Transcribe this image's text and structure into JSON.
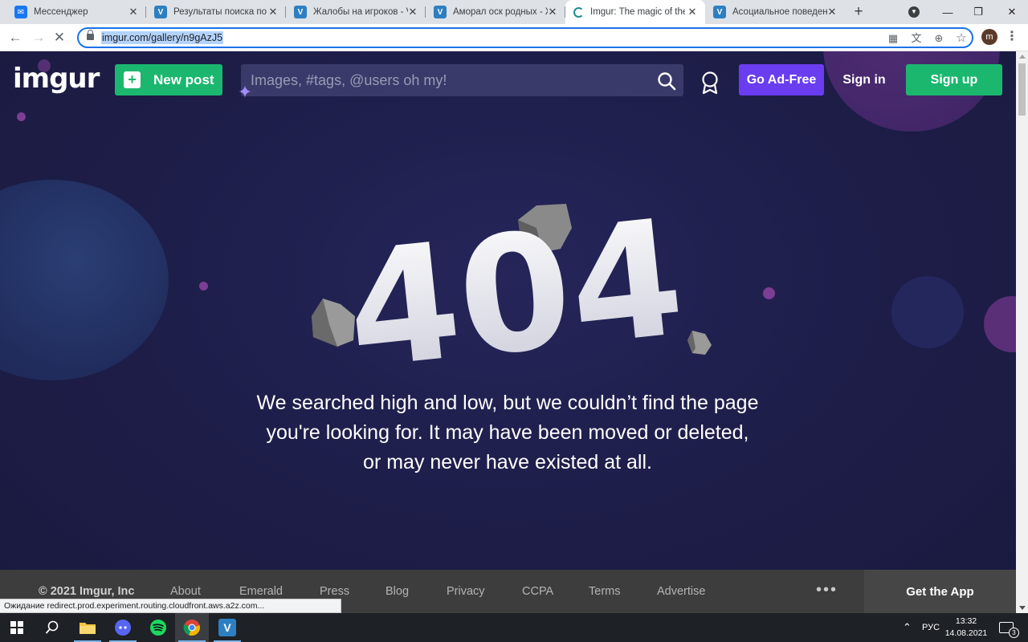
{
  "browser": {
    "tabs": [
      {
        "title": "Мессенджер",
        "favicon": "messenger-icon",
        "color": "#1877f2"
      },
      {
        "title": "Результаты поиска по \"I",
        "favicon": "vimeworld-icon",
        "color": "#2d7fc1"
      },
      {
        "title": "Жалобы на игроков - V",
        "favicon": "vimeworld-icon",
        "color": "#2d7fc1"
      },
      {
        "title": "Аморал оск родных - Ж",
        "favicon": "vimeworld-icon",
        "color": "#2d7fc1"
      },
      {
        "title": "Imgur: The magic of the",
        "favicon": "loading-spinner-icon",
        "color": "#1e8e8e",
        "active": true
      },
      {
        "title": "Асоциальное поведени",
        "favicon": "vimeworld-icon",
        "color": "#2d7fc1"
      }
    ],
    "url": "imgur.com/gallery/n9gAzJ5",
    "profile_initial": "m",
    "status_text": "Ожидание redirect.prod.experiment.routing.cloudfront.aws.a2z.com..."
  },
  "header": {
    "logo": "imgur",
    "new_post_label": "New post",
    "search_placeholder": "Images, #tags, @users oh my!",
    "ad_free_label": "Go Ad-Free",
    "sign_in_label": "Sign in",
    "sign_up_label": "Sign up"
  },
  "error": {
    "code": "404",
    "lines": [
      "We searched high and low, but we couldn’t find the page",
      "you're looking for. It may have been moved or deleted,",
      "or may never have existed at all."
    ]
  },
  "footer": {
    "copyright": "© 2021 Imgur, Inc",
    "links": [
      "About",
      "Emerald",
      "Press",
      "Blog",
      "Privacy",
      "CCPA",
      "Terms",
      "Advertise"
    ],
    "more": "•••",
    "get_app": "Get the App"
  },
  "taskbar": {
    "apps": [
      "file-explorer-icon",
      "discord-icon",
      "spotify-icon",
      "chrome-icon",
      "vimeworld-icon"
    ],
    "language": "РУС",
    "time": "13:32",
    "date": "14.08.2021",
    "notifications": "3"
  },
  "colors": {
    "page_bg": "#1b1b44",
    "green": "#1bb76e",
    "purple": "#6a3df0",
    "footer": "#3d3d3d"
  }
}
